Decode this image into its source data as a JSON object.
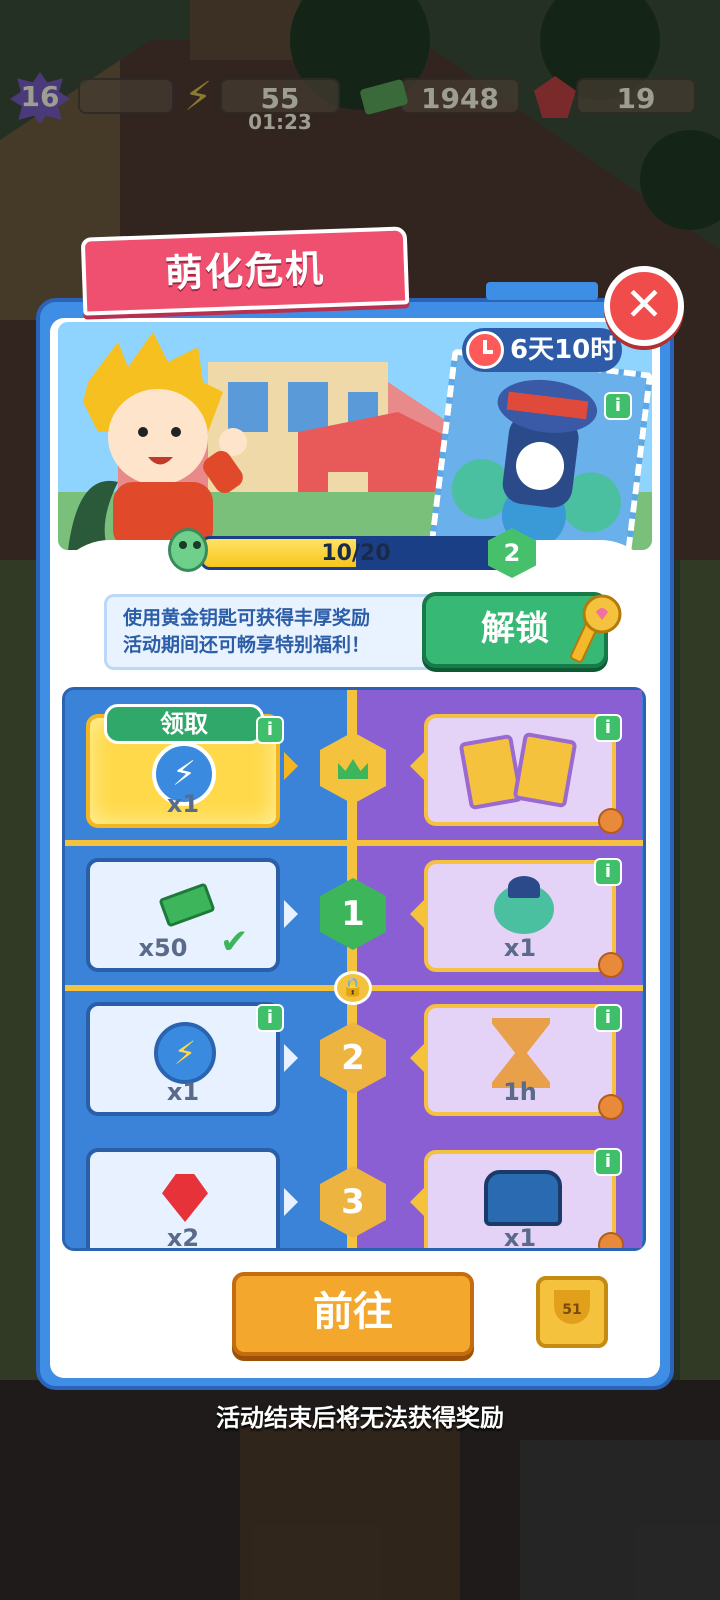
{
  "hud": {
    "level": "16",
    "energy": "55",
    "energy_timer": "01:23",
    "cash": "1948",
    "gems": "19"
  },
  "event": {
    "title": "萌化危机",
    "time_left": "6天10时",
    "progress_label": "10/20",
    "progress_fraction": 0.5,
    "level": "2"
  },
  "promo": {
    "line1": "使用黄金钥匙可获得丰厚奖励",
    "line2": "活动期间还可畅享特别福利！",
    "unlock_label": "解锁"
  },
  "rewards": {
    "claim_label": "领取",
    "rows": [
      {
        "tier": "",
        "free_qty": "x1",
        "premium_qty": ""
      },
      {
        "tier": "1",
        "free_qty": "x50",
        "premium_qty": "x1"
      },
      {
        "tier": "2",
        "free_qty": "x1",
        "premium_qty": "1h"
      },
      {
        "tier": "3",
        "free_qty": "x2",
        "premium_qty": "x1"
      }
    ],
    "info_label": "i"
  },
  "actions": {
    "go_label": "前往",
    "trophy_count": "51"
  },
  "footer": "活动结束后将无法获得奖励",
  "colors": {
    "accent_pink": "#f0506f",
    "panel_blue": "#3f8ee6",
    "unlock_green": "#38b875",
    "go_orange": "#f3a72c",
    "premium_purple": "#8b5fd4",
    "gold": "#f4c23c"
  }
}
